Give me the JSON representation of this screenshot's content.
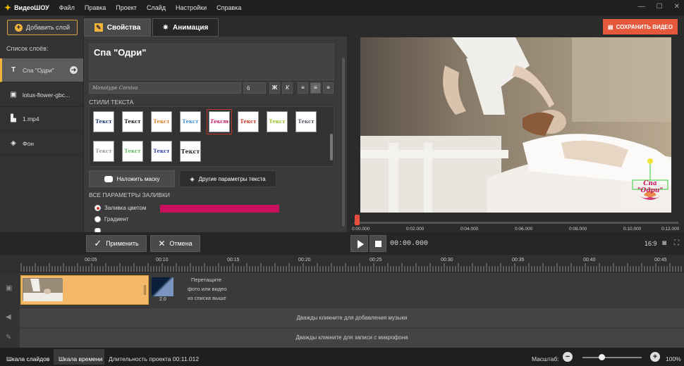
{
  "app": {
    "name": "ВидеоШОУ"
  },
  "menu": [
    "Файл",
    "Правка",
    "Проект",
    "Слайд",
    "Настройки",
    "Справка"
  ],
  "window_controls": [
    "—",
    "☐",
    "✕"
  ],
  "left": {
    "add_layer": "Добавить слой",
    "layers_title": "Список слоёв:",
    "layers": [
      {
        "label": "Спа \"Одри\"",
        "icon": "text-icon"
      },
      {
        "label": "lotus-flower-gbc...",
        "icon": "image-icon"
      },
      {
        "label": "1.mp4",
        "icon": "clapper-icon"
      },
      {
        "label": "Фон",
        "icon": "paint-bucket-icon"
      }
    ]
  },
  "tabs": {
    "properties": "Свойства",
    "animation": "Анимация"
  },
  "props": {
    "text_value": "Спа \"Одри\"",
    "font_name": "Monotype Corsiva",
    "font_size": "6",
    "format_buttons": [
      "Ж",
      "К",
      "≡",
      "≡",
      "≡"
    ],
    "styles_title": "СТИЛИ ТЕКСТА",
    "styles": [
      "Текст",
      "Текст",
      "Текст",
      "Текст",
      "Текст",
      "Текст",
      "Текст",
      "Текст",
      "Текст",
      "Текст",
      "Текст",
      "Текст"
    ],
    "mask_button": "Наложить маску",
    "other_button": "Другие параметры текста",
    "fill_title": "ВСЕ ПАРАМЕТРЫ ЗАЛИВКИ",
    "fill_color_option": "Заливка цветом",
    "gradient_option": "Градиент",
    "fill_color": "#c8105f"
  },
  "actions": {
    "apply": "Применить",
    "cancel": "Отмена"
  },
  "preview": {
    "save": "СОХРАНИТЬ ВИДЕО",
    "overlay_text": "Спа \"Одри\"",
    "progress_ticks": [
      "0:00.000",
      "0:02.000",
      "0:04.000",
      "0:06.000",
      "0:08.000",
      "0:10.000",
      "0:12.000"
    ],
    "time": "00:00.000",
    "ratio": "16:9"
  },
  "timeline": {
    "ruler": [
      "00:05",
      "00:10",
      "00:15",
      "00:20",
      "00:25",
      "00:30",
      "00:35",
      "00:40",
      "00:45"
    ],
    "transition_duration": "2.0",
    "drop_lines": [
      "Перетащите",
      "фото или видео",
      "из списка выше"
    ],
    "music_hint": "Дважды кликните для добавления музыки",
    "mic_hint": "Дважды кликните для записи с микрофона"
  },
  "status": {
    "slides_tab": "Шкала слайдов",
    "timeline_tab": "Шкала времени",
    "duration": "Длительность проекта 00:11.012",
    "zoom_label": "Масштаб:",
    "zoom_value": "100%"
  }
}
